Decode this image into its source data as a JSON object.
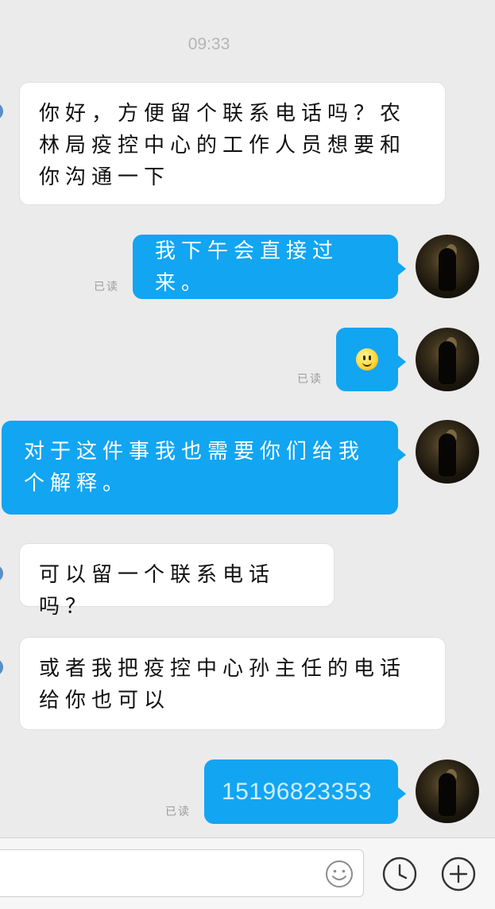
{
  "chat": {
    "timestamp": "09:33",
    "messages": [
      {
        "text": "你好，方便留个联系电话吗？农林局疫控中心的工作人员想要和你沟通一下"
      },
      {
        "text": "我下午会直接过来。",
        "status": "已读"
      },
      {
        "emoji": "smile",
        "status": "已读"
      },
      {
        "text": "对于这件事我也需要你们给我个解释。"
      },
      {
        "text": "可以留一个联系电话吗？"
      },
      {
        "text": "或者我把疫控中心孙主任的电话给你也可以"
      },
      {
        "text": "15196823353",
        "status": "已读"
      }
    ]
  },
  "input_bar": {
    "placeholder": "",
    "icons": [
      "emoji-icon",
      "clock-icon",
      "plus-icon"
    ]
  },
  "colors": {
    "background": "#ebebeb",
    "outgoing_bubble": "#12a5f2",
    "incoming_bubble": "#ffffff",
    "timestamp": "#b5b5b5",
    "read_receipt": "#9b9b9b"
  }
}
